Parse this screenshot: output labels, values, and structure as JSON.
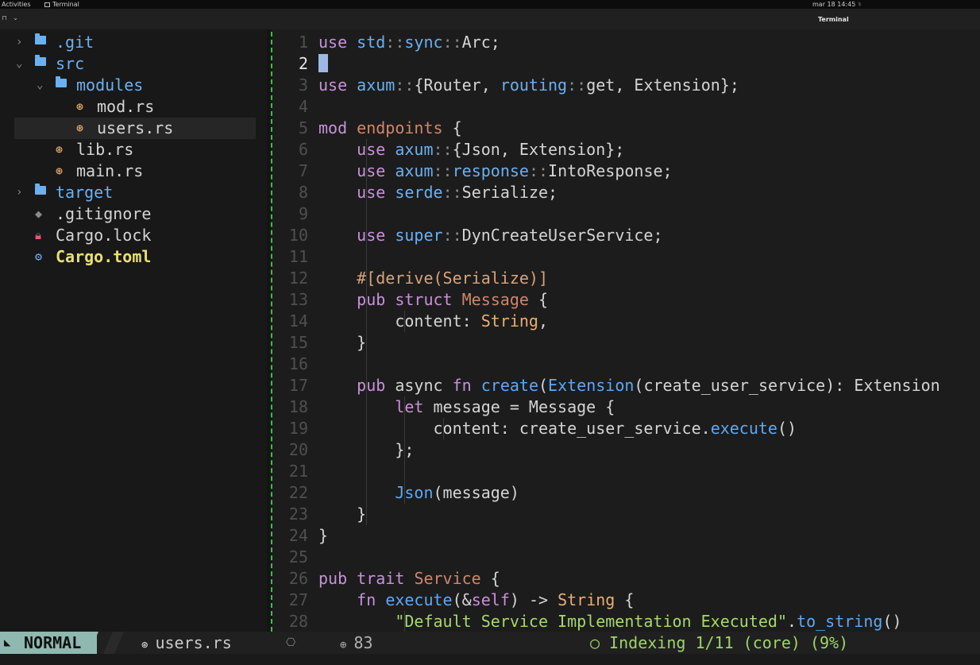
{
  "system_bar": {
    "activities": "Activities",
    "app": "Terminal",
    "clock": "mar 18  14:45",
    "bell_icon": "bell-icon"
  },
  "window": {
    "title": "Terminal"
  },
  "tree": [
    {
      "label": ".git",
      "kind": "folder",
      "depth": 0,
      "expanded": false,
      "color": "#6ab0f3"
    },
    {
      "label": "src",
      "kind": "folder",
      "depth": 0,
      "expanded": true,
      "color": "#6ab0f3"
    },
    {
      "label": "modules",
      "kind": "folder",
      "depth": 1,
      "expanded": true,
      "color": "#6ab0f3"
    },
    {
      "label": "mod.rs",
      "kind": "rust",
      "depth": 2,
      "color": "#d4d4d4",
      "icon_color": "#e8b070"
    },
    {
      "label": "users.rs",
      "kind": "rust",
      "depth": 2,
      "selected": true,
      "color": "#d4d4d4",
      "icon_color": "#e8b070"
    },
    {
      "label": "lib.rs",
      "kind": "rust",
      "depth": 1,
      "color": "#d4d4d4",
      "icon_color": "#e8b070"
    },
    {
      "label": "main.rs",
      "kind": "rust",
      "depth": 1,
      "color": "#d4d4d4",
      "icon_color": "#e8b070"
    },
    {
      "label": "target",
      "kind": "folder",
      "depth": 0,
      "expanded": false,
      "color": "#6ab0f3"
    },
    {
      "label": ".gitignore",
      "kind": "git",
      "depth": 0,
      "color": "#d4d4d4",
      "icon_color": "#8a8a8a"
    },
    {
      "label": "Cargo.lock",
      "kind": "lock",
      "depth": 0,
      "color": "#d4d4d4",
      "icon_color": "#e05a7a"
    },
    {
      "label": "Cargo.toml",
      "kind": "config",
      "depth": 0,
      "color": "#e8e070",
      "icon_color": "#6ab0f3",
      "bold": true
    }
  ],
  "editor": {
    "current_line": 2,
    "lines": [
      [
        [
          "k",
          "use"
        ],
        [
          "id",
          " "
        ],
        [
          "ns",
          "std"
        ],
        [
          "pu",
          "::"
        ],
        [
          "ns",
          "sync"
        ],
        [
          "pu",
          "::"
        ],
        [
          "id",
          "Arc;"
        ]
      ],
      [],
      [
        [
          "k",
          "use"
        ],
        [
          "id",
          " "
        ],
        [
          "ns",
          "axum"
        ],
        [
          "pu",
          "::"
        ],
        [
          "id",
          "{Router, "
        ],
        [
          "ns",
          "routing"
        ],
        [
          "pu",
          "::"
        ],
        [
          "id",
          "get, Extension};"
        ]
      ],
      [],
      [
        [
          "k",
          "mod"
        ],
        [
          "id",
          " "
        ],
        [
          "tp",
          "endpoints"
        ],
        [
          "id",
          " {"
        ]
      ],
      [
        [
          "id",
          "    "
        ],
        [
          "k",
          "use"
        ],
        [
          "id",
          " "
        ],
        [
          "ns",
          "axum"
        ],
        [
          "pu",
          "::"
        ],
        [
          "id",
          "{Json, Extension};"
        ]
      ],
      [
        [
          "id",
          "    "
        ],
        [
          "k",
          "use"
        ],
        [
          "id",
          " "
        ],
        [
          "ns",
          "axum"
        ],
        [
          "pu",
          "::"
        ],
        [
          "ns",
          "response"
        ],
        [
          "pu",
          "::"
        ],
        [
          "id",
          "IntoResponse;"
        ]
      ],
      [
        [
          "id",
          "    "
        ],
        [
          "k",
          "use"
        ],
        [
          "id",
          " "
        ],
        [
          "ns",
          "serde"
        ],
        [
          "pu",
          "::"
        ],
        [
          "id",
          "Serialize;"
        ]
      ],
      [],
      [
        [
          "id",
          "    "
        ],
        [
          "k",
          "use"
        ],
        [
          "id",
          " "
        ],
        [
          "ns",
          "super"
        ],
        [
          "pu",
          "::"
        ],
        [
          "id",
          "DynCreateUserService;"
        ]
      ],
      [],
      [
        [
          "id",
          "    "
        ],
        [
          "at",
          "#[derive(Serialize)]"
        ]
      ],
      [
        [
          "id",
          "    "
        ],
        [
          "k",
          "pub"
        ],
        [
          "id",
          " "
        ],
        [
          "k",
          "struct"
        ],
        [
          "id",
          " "
        ],
        [
          "tp",
          "Message"
        ],
        [
          "id",
          " {"
        ]
      ],
      [
        [
          "id",
          "        content: "
        ],
        [
          "ty",
          "String"
        ],
        [
          "id",
          ","
        ]
      ],
      [
        [
          "id",
          "    }"
        ]
      ],
      [],
      [
        [
          "id",
          "    "
        ],
        [
          "k",
          "pub"
        ],
        [
          "id",
          " async "
        ],
        [
          "k",
          "fn"
        ],
        [
          "id",
          " "
        ],
        [
          "fn",
          "create"
        ],
        [
          "id",
          "("
        ],
        [
          "fn",
          "Extension"
        ],
        [
          "id",
          "(create_user_service): Extension"
        ]
      ],
      [
        [
          "id",
          "        "
        ],
        [
          "k",
          "let"
        ],
        [
          "id",
          " message = Message {"
        ]
      ],
      [
        [
          "id",
          "            content: create_user_service."
        ],
        [
          "fn",
          "execute"
        ],
        [
          "id",
          "()"
        ]
      ],
      [
        [
          "id",
          "        };"
        ]
      ],
      [],
      [
        [
          "id",
          "        "
        ],
        [
          "fn",
          "Json"
        ],
        [
          "id",
          "(message)"
        ]
      ],
      [
        [
          "id",
          "    }"
        ]
      ],
      [
        [
          "id",
          "}"
        ]
      ],
      [],
      [
        [
          "k",
          "pub"
        ],
        [
          "id",
          " "
        ],
        [
          "k",
          "trait"
        ],
        [
          "id",
          " "
        ],
        [
          "tp",
          "Service"
        ],
        [
          "id",
          " {"
        ]
      ],
      [
        [
          "id",
          "    "
        ],
        [
          "k",
          "fn"
        ],
        [
          "id",
          " "
        ],
        [
          "fn",
          "execute"
        ],
        [
          "id",
          "(&"
        ],
        [
          "k",
          "self"
        ],
        [
          "id",
          ") -> "
        ],
        [
          "ty",
          "String"
        ],
        [
          "id",
          " {"
        ]
      ],
      [
        [
          "id",
          "        "
        ],
        [
          "st",
          "\"Default Service Implementation Executed\""
        ],
        [
          "id",
          "."
        ],
        [
          "fn",
          "to_string"
        ],
        [
          "id",
          "()"
        ]
      ]
    ]
  },
  "status": {
    "mode": "NORMAL",
    "file": "users.rs",
    "diagnostics": "83",
    "lsp": "○ Indexing 1/11 (core) (9%)"
  },
  "colors": {
    "mode_bg": "#8fb8b0",
    "indent_guide": "#3fbf3f",
    "background": "#1c1c1c",
    "tree_bg": "#181818"
  }
}
